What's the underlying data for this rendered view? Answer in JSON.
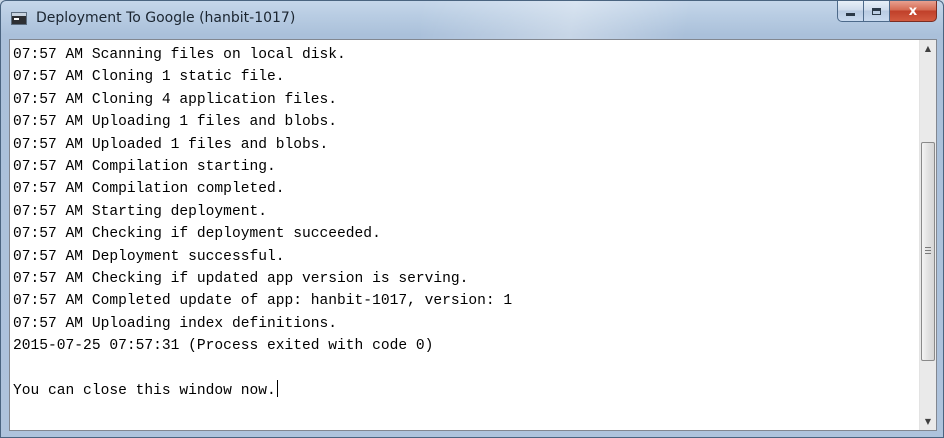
{
  "window": {
    "title": "Deployment To Google (hanbit-1017)",
    "close_label": "x"
  },
  "console": {
    "lines": [
      "07:57 AM Scanning files on local disk.",
      "07:57 AM Cloning 1 static file.",
      "07:57 AM Cloning 4 application files.",
      "07:57 AM Uploading 1 files and blobs.",
      "07:57 AM Uploaded 1 files and blobs.",
      "07:57 AM Compilation starting.",
      "07:57 AM Compilation completed.",
      "07:57 AM Starting deployment.",
      "07:57 AM Checking if deployment succeeded.",
      "07:57 AM Deployment successful.",
      "07:57 AM Checking if updated app version is serving.",
      "07:57 AM Completed update of app: hanbit-1017, version: 1",
      "07:57 AM Uploading index definitions.",
      "2015-07-25 07:57:31 (Process exited with code 0)",
      "",
      "You can close this window now."
    ]
  },
  "scrollbar": {
    "up_icon": "scroll-up-arrow-icon",
    "down_icon": "scroll-down-arrow-icon",
    "position": 0.62
  }
}
